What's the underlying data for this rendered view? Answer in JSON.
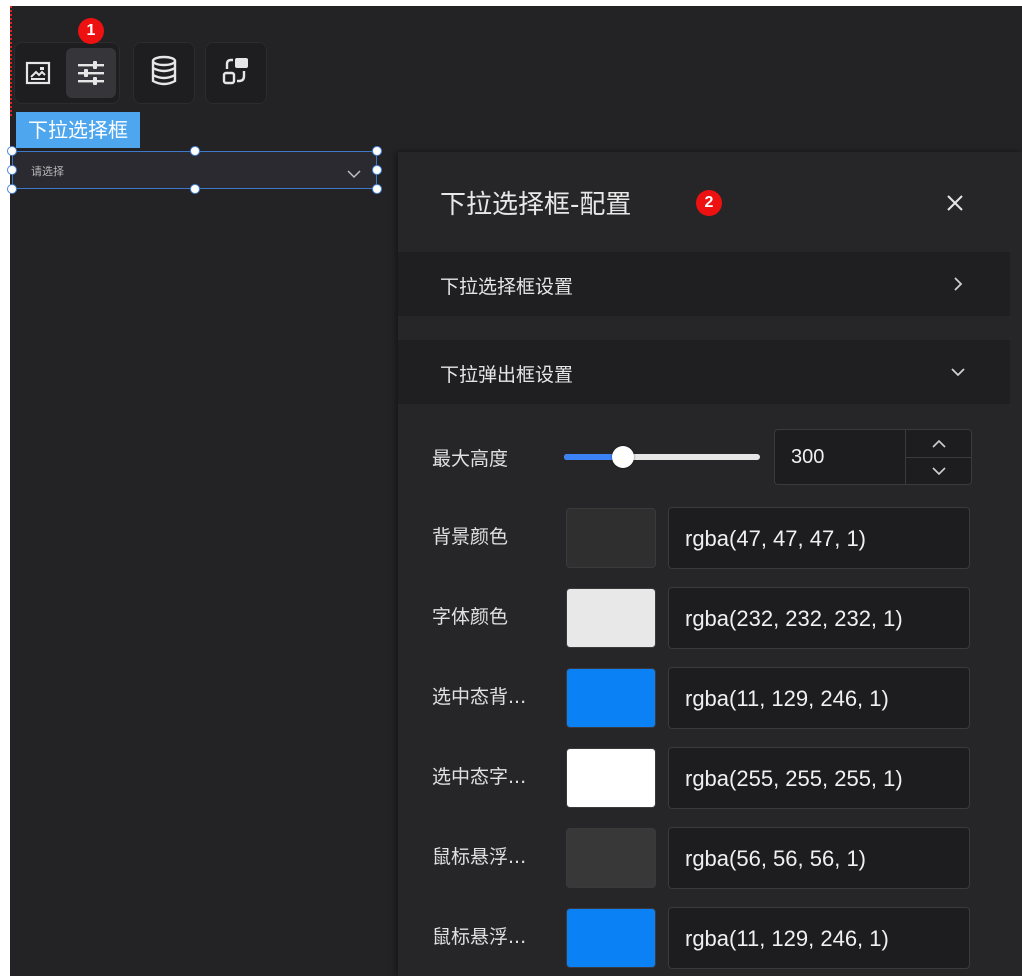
{
  "toolbar": {
    "icons": [
      "image-icon",
      "sliders-icon",
      "database-icon",
      "interaction-icon"
    ],
    "badge_1": "1",
    "badge_2": "2"
  },
  "component": {
    "tag_label": "下拉选择框",
    "placeholder": "请选择"
  },
  "panel": {
    "title": "下拉选择框-配置",
    "sections": [
      {
        "label": "下拉选择框设置",
        "expanded": false
      },
      {
        "label": "下拉弹出框设置",
        "expanded": true
      }
    ],
    "max_height": {
      "label": "最大高度",
      "value": "300",
      "slider_fraction": 0.3
    },
    "colors": [
      {
        "label": "背景颜色",
        "value": "rgba(47, 47, 47, 1)",
        "swatch": "#2f2f2f"
      },
      {
        "label": "字体颜色",
        "value": "rgba(232, 232, 232, 1)",
        "swatch": "#e8e8e8"
      },
      {
        "label": "选中态背...",
        "value": "rgba(11, 129, 246, 1)",
        "swatch": "#0b81f6"
      },
      {
        "label": "选中态字...",
        "value": "rgba(255, 255, 255, 1)",
        "swatch": "#ffffff"
      },
      {
        "label": "鼠标悬浮...",
        "value": "rgba(56, 56, 56, 1)",
        "swatch": "#383838"
      },
      {
        "label": "鼠标悬浮...",
        "value": "rgba(11, 129, 246, 1)",
        "swatch": "#0b81f6"
      }
    ]
  }
}
